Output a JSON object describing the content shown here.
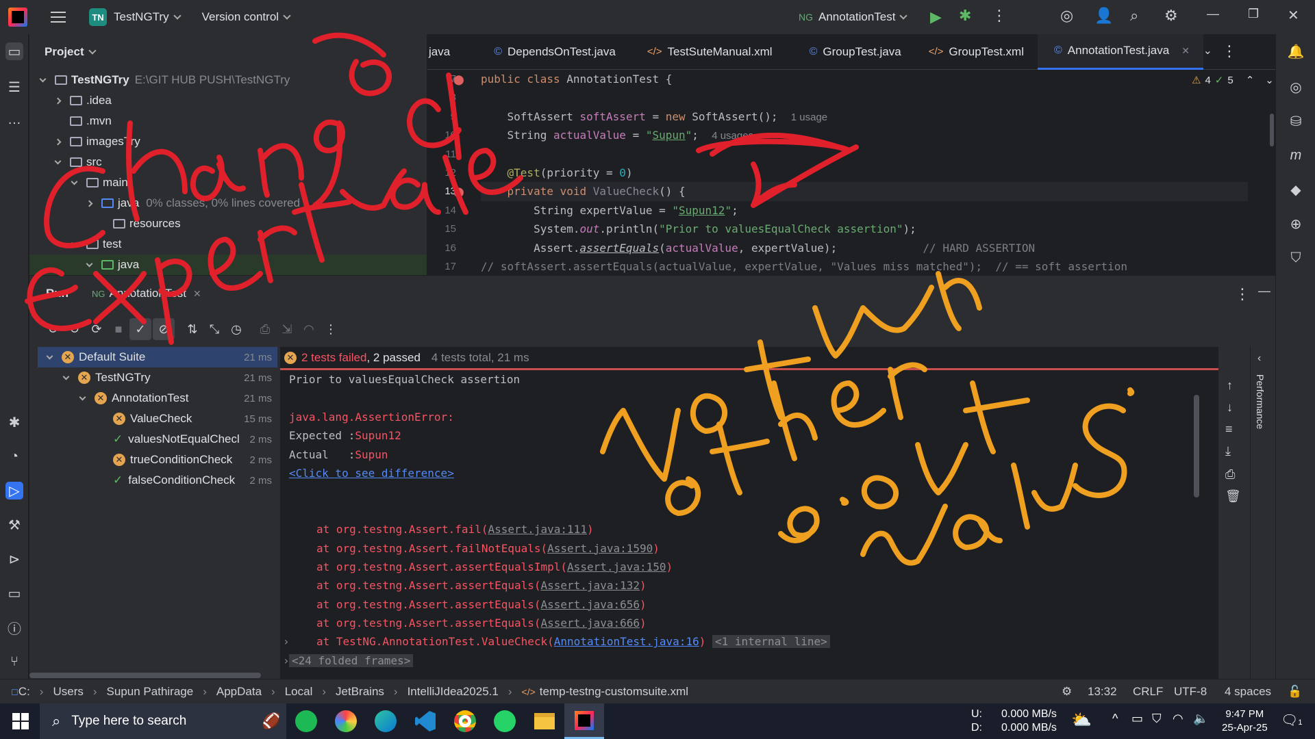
{
  "titlebar": {
    "project_badge": "TN",
    "project_name": "TestNGTry",
    "vcs": "Version control",
    "run_config": "AnnotationTest"
  },
  "project_panel": {
    "title": "Project",
    "tree": [
      {
        "label": "TestNGTry",
        "extra": "E:\\GIT HUB PUSH\\TestNGTry"
      },
      {
        "label": ".idea"
      },
      {
        "label": ".mvn"
      },
      {
        "label": "imagesTry"
      },
      {
        "label": "src"
      },
      {
        "label": "main"
      },
      {
        "label": "java",
        "extra": "0% classes, 0% lines covered"
      },
      {
        "label": "resources"
      },
      {
        "label": "test"
      },
      {
        "label": "java"
      }
    ]
  },
  "editor": {
    "tabs": [
      {
        "label": "java"
      },
      {
        "label": "DependsOnTest.java"
      },
      {
        "label": "TestSuteManual.xml"
      },
      {
        "label": "GroupTest.java"
      },
      {
        "label": "GroupTest.xml"
      },
      {
        "label": "AnnotationTest.java"
      }
    ],
    "warnings": "4",
    "checks": "5",
    "line_numbers": [
      "7",
      "8",
      "9",
      "10",
      "11",
      "12",
      "13",
      "14",
      "15",
      "16",
      "17"
    ],
    "code": {
      "l7": "public class AnnotationTest {",
      "l9_hint": "1 usage",
      "l10_hint": "4 usages",
      "l16_comment": "// HARD ASSERTION",
      "l17": "// softAssert.assertEquals(actualValue, expertValue, \"Values miss matched\");  // == soft assertion"
    }
  },
  "run_panel": {
    "tab_run": "Run",
    "tab_config": "AnnotationTest",
    "tree": [
      {
        "label": "Default Suite",
        "time": "21 ms",
        "status": "fail"
      },
      {
        "label": "TestNGTry",
        "time": "21 ms",
        "status": "fail"
      },
      {
        "label": "AnnotationTest",
        "time": "21 ms",
        "status": "fail"
      },
      {
        "label": "ValueCheck",
        "time": "15 ms",
        "status": "fail"
      },
      {
        "label": "valuesNotEqualChecl",
        "time": "2 ms",
        "status": "pass"
      },
      {
        "label": "trueConditionCheck",
        "time": "2 ms",
        "status": "fail"
      },
      {
        "label": "falseConditionCheck",
        "time": "2 ms",
        "status": "pass"
      }
    ],
    "status_failed": "2 tests failed",
    "status_passed": ", 2 passed",
    "status_total": "4 tests total, 21 ms",
    "console": {
      "l1": "Prior to valuesEqualCheck assertion",
      "l2": "java.lang.AssertionError:",
      "l3_label": "Expected :",
      "l3_val": "Supun12",
      "l4_label": "Actual   :",
      "l4_val": "Supun",
      "l5": "<Click to see difference>",
      "stack": [
        {
          "pre": "at org.testng.Assert.fail(",
          "link": "Assert.java:111",
          "post": ")"
        },
        {
          "pre": "at org.testng.Assert.failNotEquals(",
          "link": "Assert.java:1590",
          "post": ")"
        },
        {
          "pre": "at org.testng.Assert.assertEqualsImpl(",
          "link": "Assert.java:150",
          "post": ")"
        },
        {
          "pre": "at org.testng.Assert.assertEquals(",
          "link": "Assert.java:132",
          "post": ")"
        },
        {
          "pre": "at org.testng.Assert.assertEquals(",
          "link": "Assert.java:656",
          "post": ")"
        },
        {
          "pre": "at org.testng.Assert.assertEquals(",
          "link": "Assert.java:666",
          "post": ")"
        }
      ],
      "last_pre": "at TestNG.AnnotationTest.ValueCheck(",
      "last_link": "AnnotationTest.java:16",
      "last_post": ")",
      "internal": "<1 internal line>",
      "folded": "<24 folded frames>"
    },
    "side_label": "Performance"
  },
  "statusbar": {
    "crumbs": [
      "C:",
      "Users",
      "Supun Pathirage",
      "AppData",
      "Local",
      "JetBrains",
      "IntelliJIdea2025.1",
      "temp-testng-customsuite.xml"
    ],
    "position": "13:32",
    "line_sep": "CRLF",
    "encoding": "UTF-8",
    "indent": "4 spaces"
  },
  "taskbar": {
    "search_placeholder": "Type here to search",
    "net_u_label": "U:",
    "net_u": "0.000 MB/s",
    "net_d_label": "D:",
    "net_d": "0.000 MB/s",
    "time": "9:47 PM",
    "date": "25-Apr-25",
    "notif_count": "1"
  },
  "annotations": {
    "red_text": "Changed ExpertValue",
    "orange_text": "Not run other s.out values."
  }
}
